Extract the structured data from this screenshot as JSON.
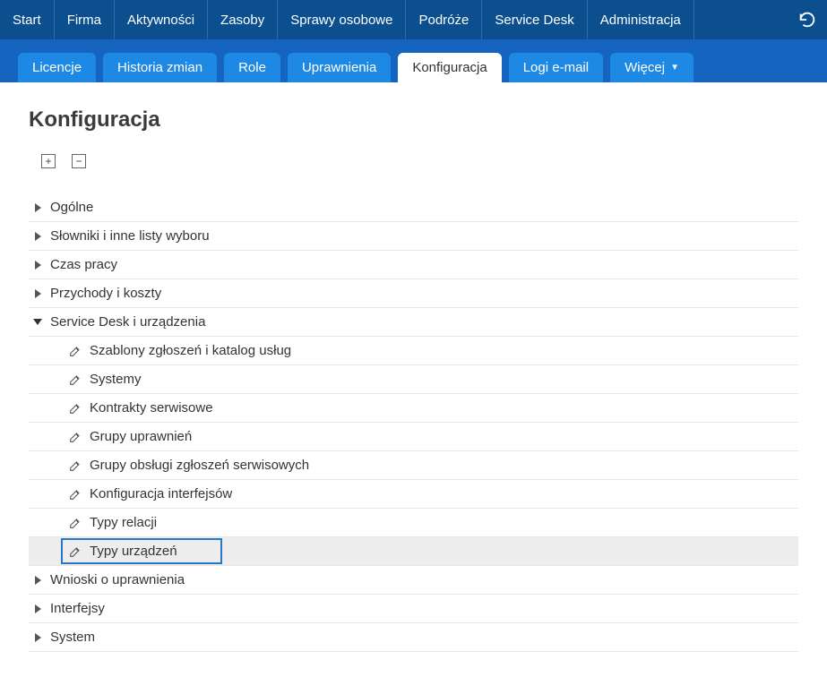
{
  "topnav": {
    "items": [
      "Start",
      "Firma",
      "Aktywności",
      "Zasoby",
      "Sprawy osobowe",
      "Podróże",
      "Service Desk",
      "Administracja"
    ]
  },
  "subnav": {
    "tabs": [
      {
        "label": "Licencje",
        "active": false
      },
      {
        "label": "Historia zmian",
        "active": false
      },
      {
        "label": "Role",
        "active": false
      },
      {
        "label": "Uprawnienia",
        "active": false
      },
      {
        "label": "Konfiguracja",
        "active": true
      },
      {
        "label": "Logi e-mail",
        "active": false
      },
      {
        "label": "Więcej",
        "active": false,
        "dropdown": true
      }
    ]
  },
  "page": {
    "title": "Konfiguracja"
  },
  "tree": {
    "nodes": [
      {
        "label": "Ogólne",
        "expanded": false
      },
      {
        "label": "Słowniki i inne listy wyboru",
        "expanded": false
      },
      {
        "label": "Czas pracy",
        "expanded": false
      },
      {
        "label": "Przychody i koszty",
        "expanded": false
      },
      {
        "label": "Service Desk i urządzenia",
        "expanded": true,
        "children": [
          {
            "label": "Szablony zgłoszeń i katalog usług"
          },
          {
            "label": "Systemy"
          },
          {
            "label": "Kontrakty serwisowe"
          },
          {
            "label": "Grupy uprawnień"
          },
          {
            "label": "Grupy obsługi zgłoszeń serwisowych"
          },
          {
            "label": "Konfiguracja interfejsów"
          },
          {
            "label": "Typy relacji"
          },
          {
            "label": "Typy urządzeń",
            "highlight": true
          }
        ]
      },
      {
        "label": "Wnioski o uprawnienia",
        "expanded": false
      },
      {
        "label": "Interfejsy",
        "expanded": false
      },
      {
        "label": "System",
        "expanded": false
      }
    ]
  }
}
